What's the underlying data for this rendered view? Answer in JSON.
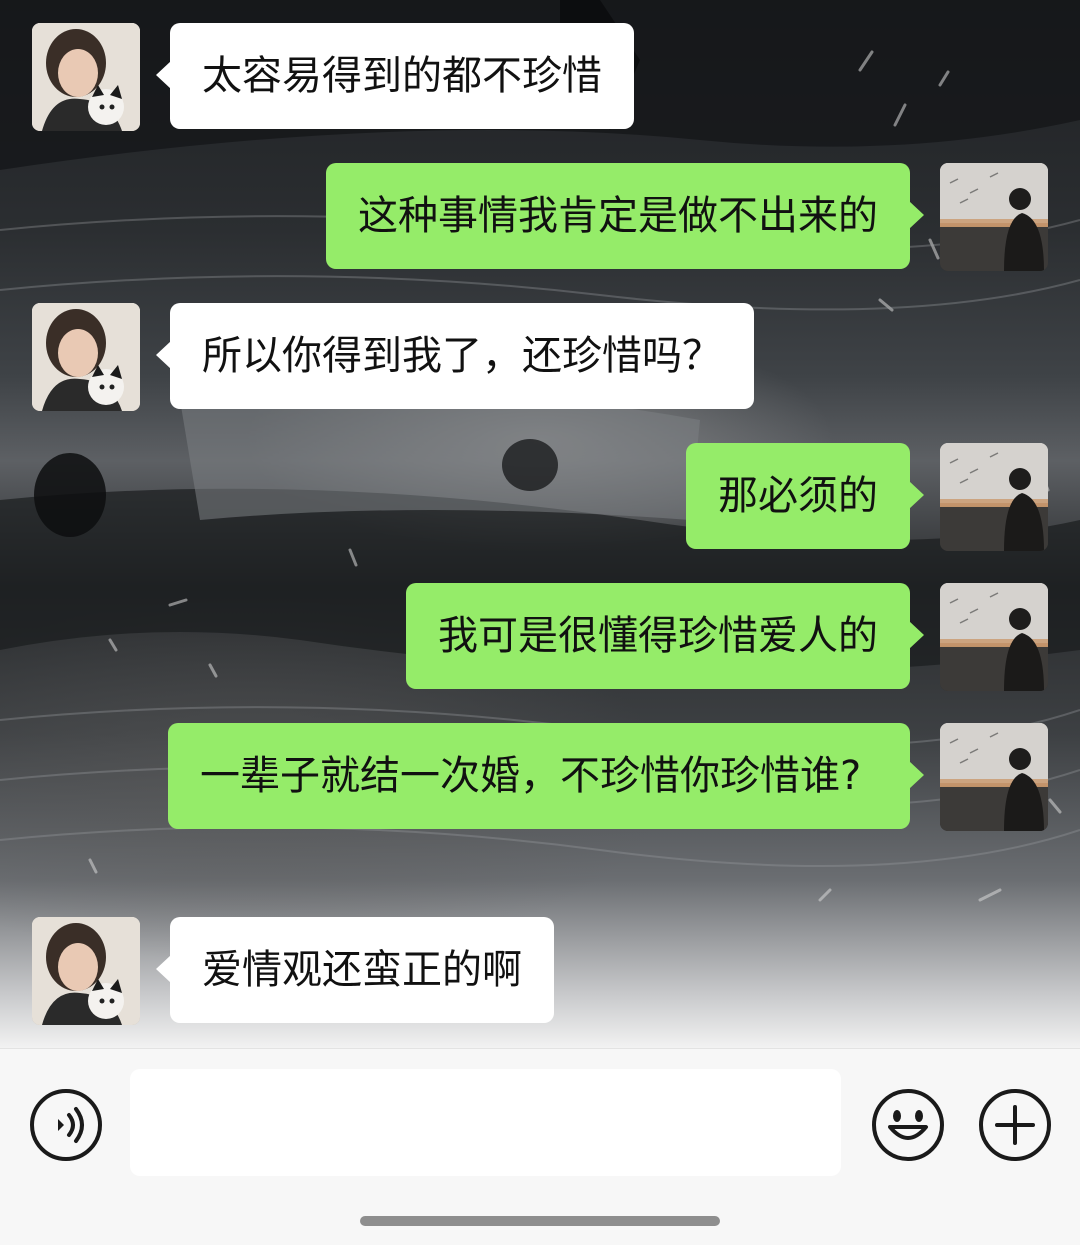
{
  "conversation": {
    "messages": [
      {
        "side": "in",
        "text": "太容易得到的都不珍惜"
      },
      {
        "side": "out",
        "text": "这种事情我肯定是做不出来的"
      },
      {
        "side": "in",
        "text": "所以你得到我了，还珍惜吗？"
      },
      {
        "side": "out",
        "text": "那必须的"
      },
      {
        "side": "out",
        "text": "我可是很懂得珍惜爱人的"
      },
      {
        "side": "out",
        "text": "一辈子就结一次婚，不珍惜你珍惜谁?"
      },
      {
        "side": "in",
        "text": "爱情观还蛮正的啊"
      }
    ],
    "bubble_colors": {
      "incoming": "#ffffff",
      "outgoing": "#95ec69"
    }
  },
  "input_bar": {
    "text_value": "",
    "voice_icon": "voice-icon",
    "emoji_icon": "smiley-face-icon",
    "plus_icon": "plus-circle-icon"
  }
}
